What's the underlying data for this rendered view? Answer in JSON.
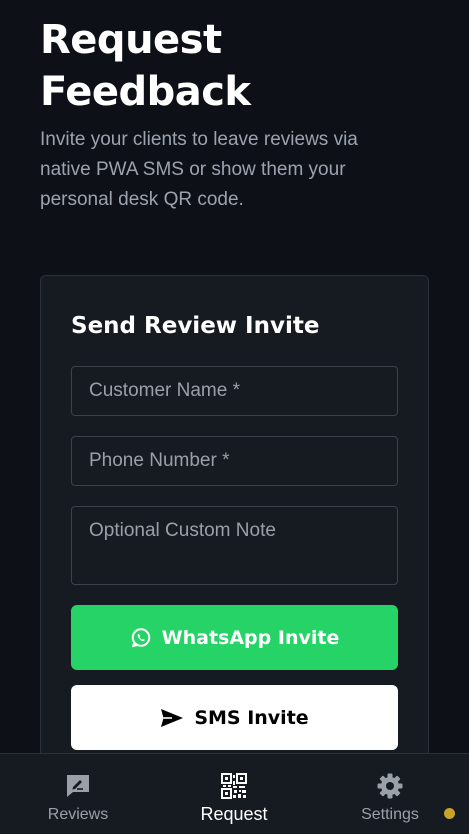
{
  "header": {
    "title": "Request Feedback",
    "subtitle": "Invite your clients to leave reviews via native PWA SMS or show them your personal desk QR code."
  },
  "invite_card": {
    "title": "Send Review Invite",
    "customer_name_placeholder": "Customer Name *",
    "customer_name_value": "",
    "phone_placeholder": "Phone Number *",
    "phone_value": "",
    "note_placeholder": "Optional Custom Note",
    "note_value": "",
    "whatsapp_label": "WhatsApp Invite",
    "sms_label": "SMS Invite"
  },
  "nav": {
    "items": [
      {
        "label": "Reviews",
        "icon": "reviews-icon",
        "active": false
      },
      {
        "label": "Request",
        "icon": "qr-code-icon",
        "active": true
      },
      {
        "label": "Settings",
        "icon": "gear-icon",
        "active": false
      }
    ]
  },
  "colors": {
    "background": "#0d1117",
    "card": "#161b22",
    "whatsapp_green": "#25d366",
    "status_dot": "#c9a227"
  }
}
